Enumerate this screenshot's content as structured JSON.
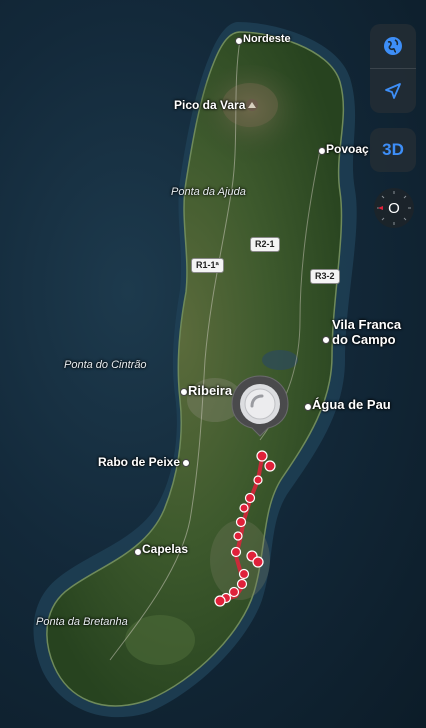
{
  "map": {
    "places": {
      "nordeste": "Nordeste",
      "pico_da_vara": "Pico da Vara",
      "povoacao": "Povoaç",
      "ponta_da_ajuda": "Ponta da Ajuda",
      "ponta_do_cintrao": "Ponta do Cintrão",
      "ribeira": "Ribeira",
      "vila_franca": "Vila Franca\ndo Campo",
      "agua_de_pau": "Água de Pau",
      "rabo_de_peixe": "Rabo de Peixe",
      "capelas": "Capelas",
      "ponta_da_bretanha": "Ponta da Bretanha"
    },
    "roads": {
      "r1": "R1-1ª",
      "r2": "R2-1",
      "r3": "R3-2"
    }
  },
  "controls": {
    "globe_icon": "globe-icon",
    "location_icon": "location-arrow-icon",
    "three_d_label": "3D",
    "compass_letter": "O"
  },
  "colors": {
    "accent": "#3d8ef7",
    "track": "#e0213a",
    "land": "#3b5a2c"
  }
}
